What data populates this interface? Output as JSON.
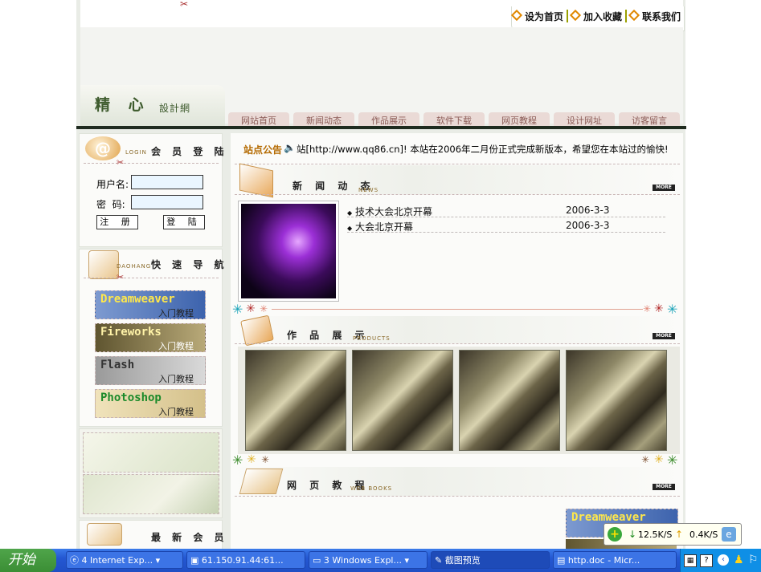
{
  "header": {
    "links": [
      "设为首页",
      "加入收藏",
      "联系我们"
    ]
  },
  "logo": {
    "text": "精 心",
    "sub": "設計網"
  },
  "nav": [
    "网站首页",
    "新闻动态",
    "作品展示",
    "软件下载",
    "网页教程",
    "设计网址",
    "访客留言"
  ],
  "login": {
    "title": "会 员 登 陆",
    "tag": "LOGIN",
    "username_label": "用户名:",
    "password_label": "密  码:",
    "register_label": "注 册",
    "login_label": "登 陆"
  },
  "quicknav": {
    "title": "快 速 导 航",
    "tag": "DAOHANG",
    "items": [
      {
        "name": "Dreamweaver",
        "sub": "入门教程",
        "color": "#2f4f8f"
      },
      {
        "name": "Fireworks",
        "sub": "入门教程",
        "color": "#7a6a2a"
      },
      {
        "name": "Flash",
        "sub": "入门教程",
        "color": "#555555"
      },
      {
        "name": "Photoshop",
        "sub": "入门教程",
        "color": "#1a8a2a"
      }
    ]
  },
  "members": {
    "title": "最 新 会 员"
  },
  "notice": {
    "label": "站点公告",
    "text": "站[http://www.qq86.cn]! 本站在2006年二月份正式完成新版本，希望您在本站过的愉快!"
  },
  "news": {
    "title": "新 闻 动 态",
    "tag": "NEWS",
    "more": "MORE",
    "items": [
      {
        "title": "技术大会北京开幕",
        "date": "2006-3-3"
      },
      {
        "title": "大会北京开幕",
        "date": "2006-3-3"
      }
    ]
  },
  "products": {
    "title": "作 品 展 示",
    "tag": "PRODUCTS",
    "more": "MORE"
  },
  "books": {
    "title": "网 页 教 程",
    "tag": "WEB BOOKS",
    "more": "MORE",
    "featured": "Dreamweaver"
  },
  "netspeed": {
    "down": "12.5K/S",
    "up": "0.4K/S"
  },
  "taskbar": {
    "start": "开始",
    "tasks": [
      "4 Internet Exp...",
      "61.150.91.44:61...",
      "3 Windows Expl...",
      "截图预览",
      "http.doc - Micr..."
    ]
  }
}
